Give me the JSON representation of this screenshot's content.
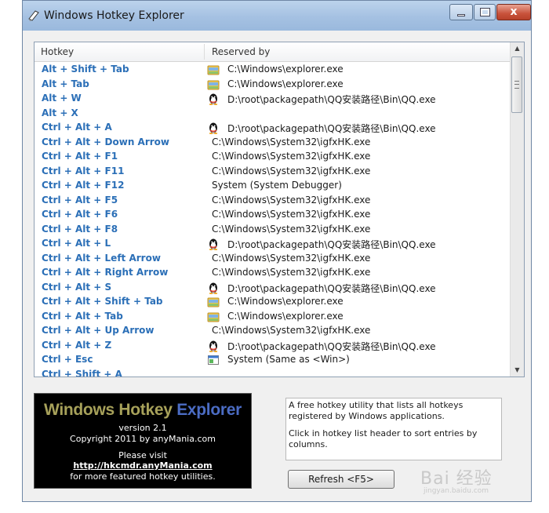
{
  "window": {
    "title": "Windows Hotkey Explorer",
    "close_glyph": "x"
  },
  "list": {
    "columns": {
      "hotkey": "Hotkey",
      "reserved_by": "Reserved by"
    },
    "rows": [
      {
        "hotkey": "Alt + Shift + Tab",
        "path": "C:\\Windows\\explorer.exe",
        "icon": "explorer-icon"
      },
      {
        "hotkey": "Alt + Tab",
        "path": "C:\\Windows\\explorer.exe",
        "icon": "explorer-icon"
      },
      {
        "hotkey": "Alt + W",
        "path": "D:\\root\\packagepath\\QQ安装路径\\Bin\\QQ.exe",
        "icon": "qq-penguin-icon"
      },
      {
        "hotkey": "Alt + X",
        "path": "",
        "icon": ""
      },
      {
        "hotkey": "Ctrl + Alt + A",
        "path": "D:\\root\\packagepath\\QQ安装路径\\Bin\\QQ.exe",
        "icon": "qq-penguin-icon"
      },
      {
        "hotkey": "Ctrl + Alt + Down Arrow",
        "path": "C:\\Windows\\System32\\igfxHK.exe",
        "icon": ""
      },
      {
        "hotkey": "Ctrl + Alt + F1",
        "path": "C:\\Windows\\System32\\igfxHK.exe",
        "icon": ""
      },
      {
        "hotkey": "Ctrl + Alt + F11",
        "path": "C:\\Windows\\System32\\igfxHK.exe",
        "icon": ""
      },
      {
        "hotkey": "Ctrl + Alt + F12",
        "path": "System (System Debugger)",
        "icon": ""
      },
      {
        "hotkey": "Ctrl + Alt + F5",
        "path": "C:\\Windows\\System32\\igfxHK.exe",
        "icon": ""
      },
      {
        "hotkey": "Ctrl + Alt + F6",
        "path": "C:\\Windows\\System32\\igfxHK.exe",
        "icon": ""
      },
      {
        "hotkey": "Ctrl + Alt + F8",
        "path": "C:\\Windows\\System32\\igfxHK.exe",
        "icon": ""
      },
      {
        "hotkey": "Ctrl + Alt + L",
        "path": "D:\\root\\packagepath\\QQ安装路径\\Bin\\QQ.exe",
        "icon": "qq-penguin-icon"
      },
      {
        "hotkey": "Ctrl + Alt + Left Arrow",
        "path": "C:\\Windows\\System32\\igfxHK.exe",
        "icon": ""
      },
      {
        "hotkey": "Ctrl + Alt + Right Arrow",
        "path": "C:\\Windows\\System32\\igfxHK.exe",
        "icon": ""
      },
      {
        "hotkey": "Ctrl + Alt + S",
        "path": "D:\\root\\packagepath\\QQ安装路径\\Bin\\QQ.exe",
        "icon": "qq-penguin-icon"
      },
      {
        "hotkey": "Ctrl + Alt + Shift + Tab",
        "path": "C:\\Windows\\explorer.exe",
        "icon": "explorer-icon"
      },
      {
        "hotkey": "Ctrl + Alt + Tab",
        "path": "C:\\Windows\\explorer.exe",
        "icon": "explorer-icon"
      },
      {
        "hotkey": "Ctrl + Alt + Up Arrow",
        "path": "C:\\Windows\\System32\\igfxHK.exe",
        "icon": ""
      },
      {
        "hotkey": "Ctrl + Alt + Z",
        "path": "D:\\root\\packagepath\\QQ安装路径\\Bin\\QQ.exe",
        "icon": "qq-penguin-icon"
      },
      {
        "hotkey": "Ctrl + Esc",
        "path": "System (Same as <Win>)",
        "icon": "system-window-icon"
      },
      {
        "hotkey": "Ctrl + Shift + A",
        "path": "",
        "icon": ""
      }
    ]
  },
  "banner": {
    "title_part1": "Windows Hotkey",
    "title_part2": "Explorer",
    "version": "version 2.1",
    "copyright": "Copyright 2011 by anyMania.com",
    "visit": "Please visit",
    "link": "http://hkcmdr.anyMania.com",
    "more": "for more featured hotkey utilities."
  },
  "info": {
    "line1": "A free hotkey utility that lists all hotkeys registered by Windows applications.",
    "line2": "Click in hotkey list header to sort entries by columns."
  },
  "refresh_button": {
    "label": "Refresh <F5>"
  },
  "watermark": {
    "brand": "Bai 经验",
    "url": "jingyan.baidu.com"
  },
  "colors": {
    "hotkey_text": "#2b6fb7",
    "titlebar": "#a5c1e2",
    "banner_title_1": "#a7a15a",
    "banner_title_2": "#4b6cc4"
  }
}
